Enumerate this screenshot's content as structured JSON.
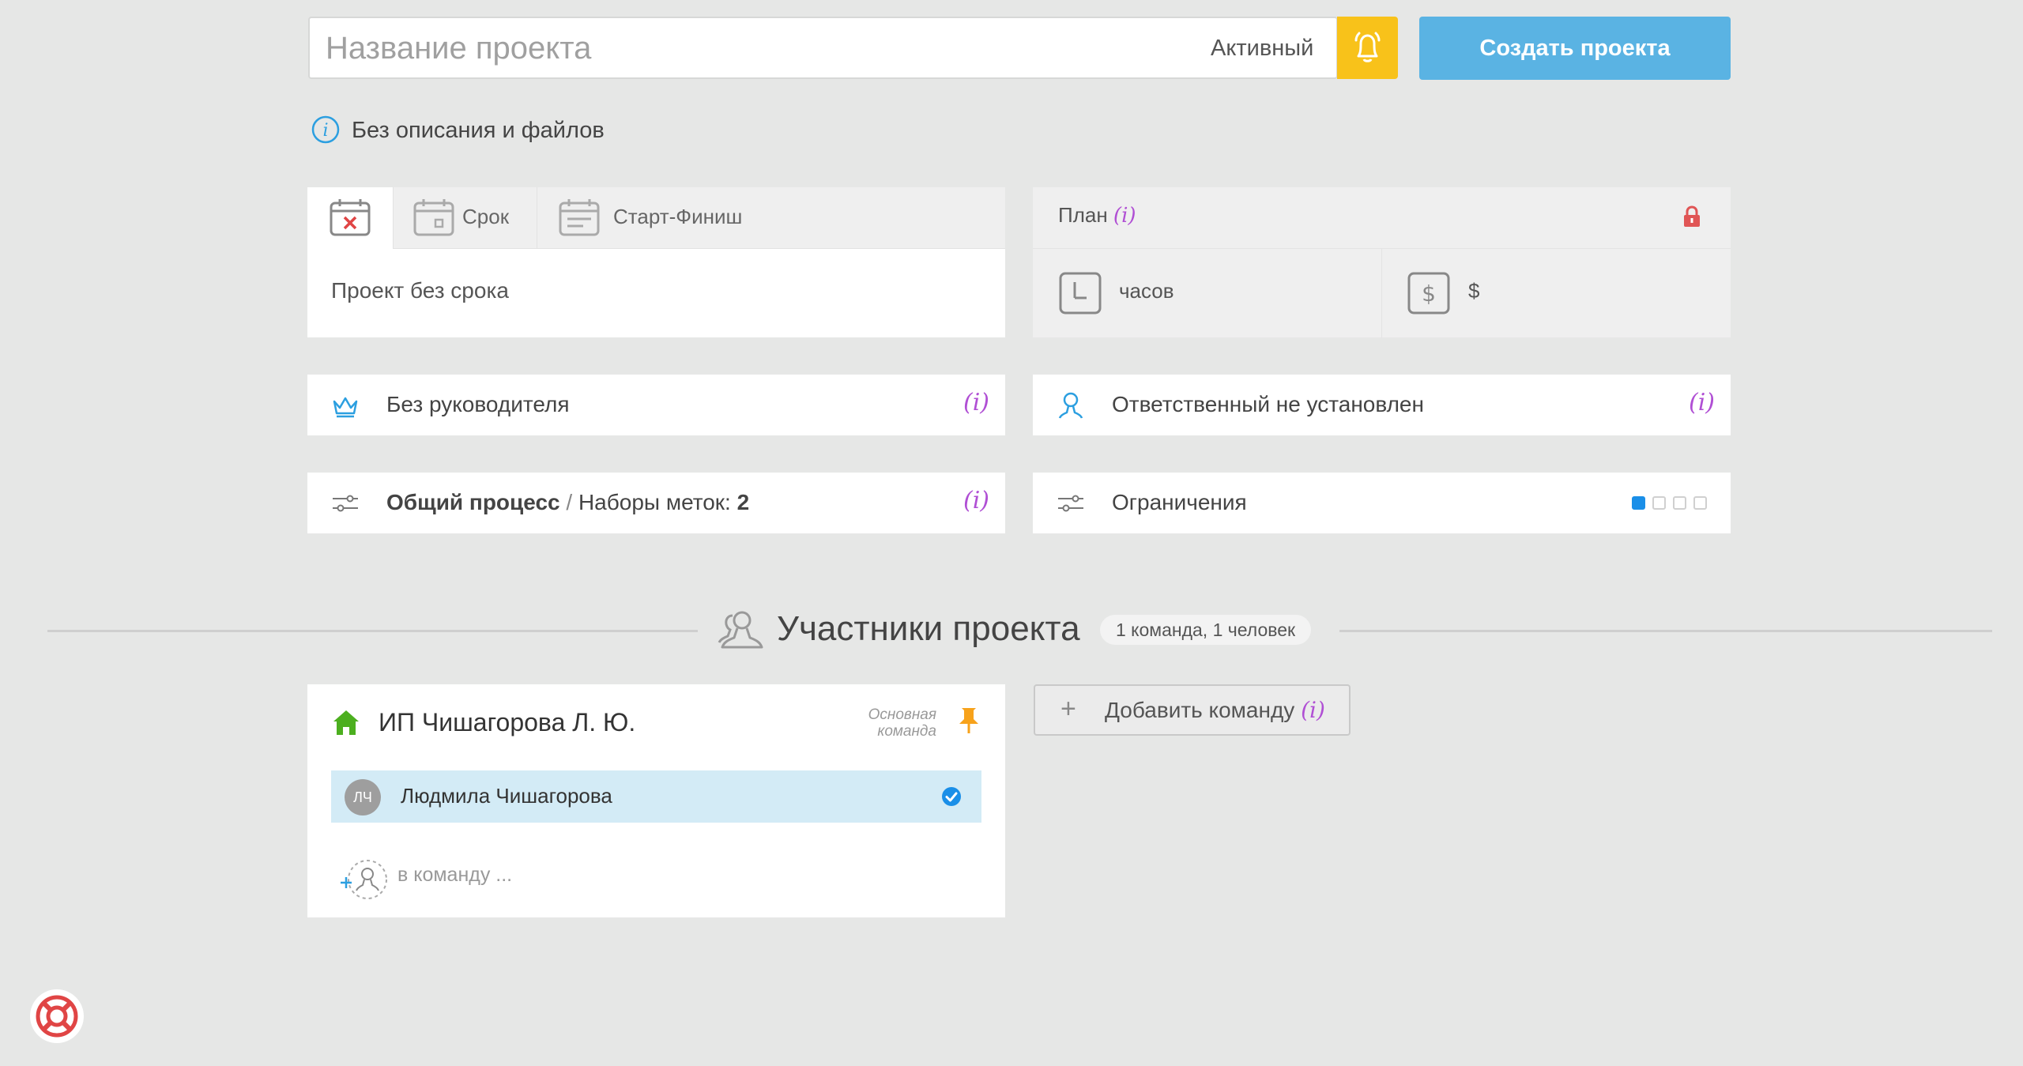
{
  "header": {
    "project_name_placeholder": "Название проекта",
    "status": "Активный",
    "create_button": "Создать проекта"
  },
  "description": {
    "text": "Без описания и файлов"
  },
  "dates": {
    "tabs": [
      {
        "label": ""
      },
      {
        "label": "Срок"
      },
      {
        "label": "Старт-Финиш"
      }
    ],
    "value": "Проект без срока"
  },
  "plan": {
    "label": "План",
    "info": "(i)",
    "hours_label": "часов",
    "money_label": "$"
  },
  "manager": {
    "text": "Без руководителя",
    "info": "(i)"
  },
  "responsible": {
    "text": "Ответственный не установлен",
    "info": "(i)"
  },
  "process": {
    "name": "Общий процесс",
    "separator": " / ",
    "tags_label": "Наборы меток: ",
    "tags_count": "2",
    "info": "(i)"
  },
  "restrictions": {
    "text": "Ограничения",
    "level": 1,
    "levels_total": 4
  },
  "participants": {
    "title": "Участники проекта",
    "summary": "1 команда, 1 человек",
    "team": {
      "name": "ИП Чишагорова Л. Ю.",
      "main_label_line1": "Основная",
      "main_label_line2": "команда",
      "member": {
        "initials": "ЛЧ",
        "name": "Людмила Чишагорова"
      },
      "add_member_placeholder": "в команду ..."
    },
    "add_team_button": "Добавить команду",
    "add_team_info": "(i)"
  },
  "colors": {
    "accent_blue": "#5ab3e3",
    "bell_yellow": "#f8c21a",
    "info_purple": "#b04fd4",
    "home_green": "#4caf1f",
    "pin_orange": "#f7a21b",
    "lock_red": "#e05555"
  },
  "icons": [
    "bell-icon",
    "info-icon",
    "calendar-x-icon",
    "calendar-icon",
    "calendar-range-icon",
    "lock-icon",
    "clock-icon",
    "dollar-icon",
    "crown-icon",
    "user-icon",
    "sliders-icon",
    "users-icon",
    "home-icon",
    "pin-icon",
    "check-icon",
    "add-user-icon",
    "lifebuoy-icon"
  ]
}
